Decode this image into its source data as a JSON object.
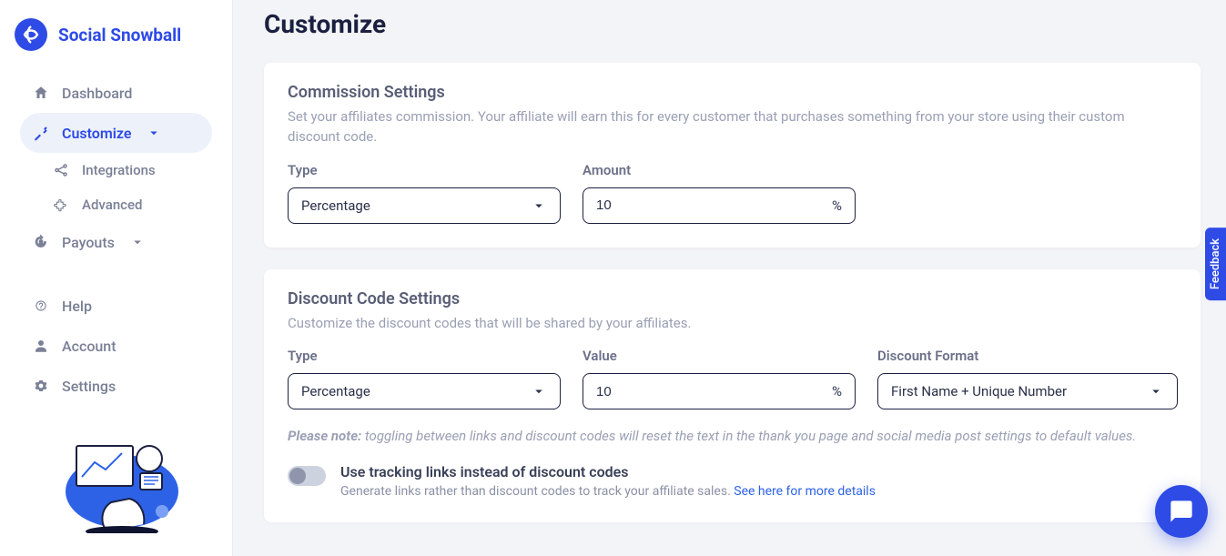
{
  "brand": {
    "name": "Social Snowball"
  },
  "sidebar": {
    "items": {
      "dashboard": "Dashboard",
      "customize": "Customize",
      "integrations": "Integrations",
      "advanced": "Advanced",
      "payouts": "Payouts",
      "help": "Help",
      "account": "Account",
      "settings": "Settings"
    }
  },
  "page": {
    "title": "Customize"
  },
  "commission": {
    "title": "Commission Settings",
    "desc": "Set your affiliates commission. Your affiliate will earn this for every customer that purchases something from your store using their custom discount code.",
    "type_label": "Type",
    "type_value": "Percentage",
    "amount_label": "Amount",
    "amount_value": "10",
    "amount_suffix": "%"
  },
  "discount": {
    "title": "Discount Code Settings",
    "desc": "Customize the discount codes that will be shared by your affiliates.",
    "type_label": "Type",
    "type_value": "Percentage",
    "value_label": "Value",
    "value_value": "10",
    "value_suffix": "%",
    "format_label": "Discount Format",
    "format_value": "First Name + Unique Number",
    "note_bold": "Please note:",
    "note_text": " toggling between links and discount codes will reset the text in the thank you page and social media post settings to default values.",
    "toggle_title": "Use tracking links instead of discount codes",
    "toggle_sub": "Generate links rather than discount codes to track your affiliate sales. ",
    "toggle_link": "See here for more details"
  },
  "feedback": "Feedback"
}
